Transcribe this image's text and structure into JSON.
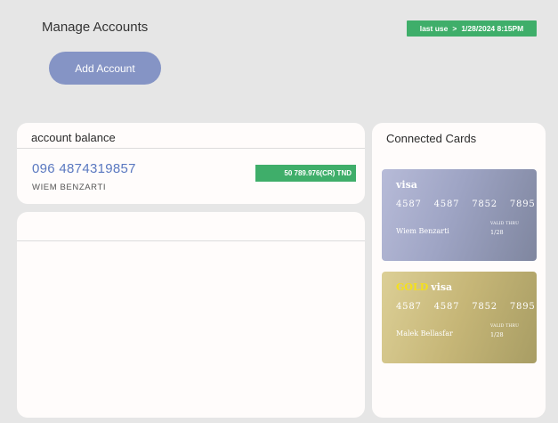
{
  "header": {
    "title": "Manage Accounts",
    "last_use_label": "last use",
    "last_use_separator": ">",
    "last_use_value": "1/28/2024 8:15PM",
    "add_account_label": "Add Account"
  },
  "balance_panel": {
    "title": "account balance",
    "account_number": "096 4874319857",
    "account_owner": "WIEM BENZARTI",
    "balance": "50 789.976(CR) TND"
  },
  "cards_panel": {
    "title": "Connected Cards",
    "cards": [
      {
        "tier": "",
        "brand": "visa",
        "number": "4587 4587 7852 7895",
        "holder": "Wiem Benzarti",
        "valid_label": "VALID THRU",
        "valid_date": "1/28"
      },
      {
        "tier": "GOLD",
        "brand": "visa",
        "number": "4587 4587 7852 7895",
        "holder": "Malek Bellasfar",
        "valid_label": "VALID THRU",
        "valid_date": "1/28"
      }
    ]
  },
  "colors": {
    "accent_green": "#3fae6a",
    "button_blue": "#8594c5",
    "account_number_blue": "#5a78c0",
    "gold_text": "#f5e11a"
  }
}
